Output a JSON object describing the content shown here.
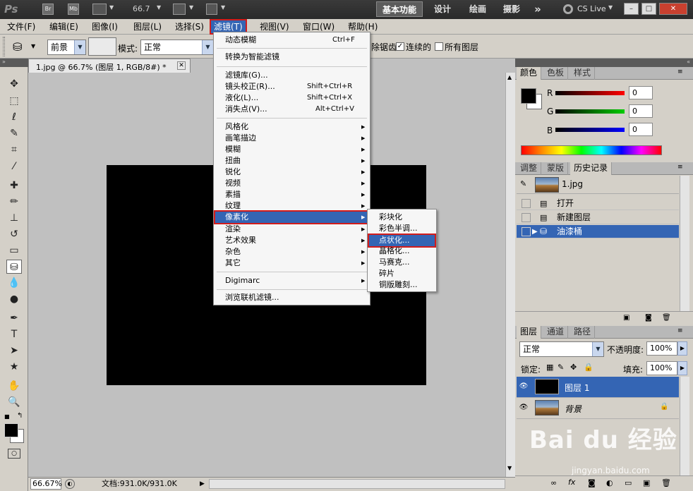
{
  "titlebar": {
    "logo": "Ps",
    "bridge": "Br",
    "minibridge": "Mb",
    "zoom": "66.7",
    "workspaces": [
      "基本功能",
      "设计",
      "绘画",
      "摄影"
    ],
    "more": "»",
    "cslive": "CS Live",
    "win_min": "–",
    "win_max": "□",
    "win_close": "✕"
  },
  "menubar": [
    "文件(F)",
    "编辑(E)",
    "图像(I)",
    "图层(L)",
    "选择(S)",
    "滤镜(T)",
    "视图(V)",
    "窗口(W)",
    "帮助(H)"
  ],
  "options": {
    "fill_source": "前景",
    "mode_label": "模式:",
    "mode_value": "正常",
    "antialias": "除锯齿",
    "contiguous": "连续的",
    "all_layers": "所有图层"
  },
  "document": {
    "tab_title": "1.jpg @ 66.7% (图层 1, RGB/8#) *",
    "zoom": "66.67%",
    "doc_size": "文档:931.0K/931.0K"
  },
  "filter_menu": {
    "items": [
      {
        "label": "动态模糊",
        "shortcut": "Ctrl+F"
      },
      {
        "label": "转换为智能滤镜",
        "shortcut": ""
      },
      {
        "label": "滤镜库(G)...",
        "shortcut": ""
      },
      {
        "label": "镜头校正(R)...",
        "shortcut": "Shift+Ctrl+R"
      },
      {
        "label": "液化(L)...",
        "shortcut": "Shift+Ctrl+X"
      },
      {
        "label": "消失点(V)...",
        "shortcut": "Alt+Ctrl+V"
      },
      {
        "label": "风格化",
        "shortcut": ""
      },
      {
        "label": "画笔描边",
        "shortcut": ""
      },
      {
        "label": "模糊",
        "shortcut": ""
      },
      {
        "label": "扭曲",
        "shortcut": ""
      },
      {
        "label": "锐化",
        "shortcut": ""
      },
      {
        "label": "视频",
        "shortcut": ""
      },
      {
        "label": "素描",
        "shortcut": ""
      },
      {
        "label": "纹理",
        "shortcut": ""
      },
      {
        "label": "像素化",
        "shortcut": ""
      },
      {
        "label": "渲染",
        "shortcut": ""
      },
      {
        "label": "艺术效果",
        "shortcut": ""
      },
      {
        "label": "杂色",
        "shortcut": ""
      },
      {
        "label": "其它",
        "shortcut": ""
      },
      {
        "label": "Digimarc",
        "shortcut": ""
      },
      {
        "label": "浏览联机滤镜...",
        "shortcut": ""
      }
    ]
  },
  "pixelate_menu": [
    "彩块化",
    "彩色半调...",
    "点状化...",
    "晶格化...",
    "马赛克...",
    "碎片",
    "铜版雕刻..."
  ],
  "color_panel": {
    "tabs": [
      "颜色",
      "色板",
      "样式"
    ],
    "r_label": "R",
    "g_label": "G",
    "b_label": "B",
    "r_value": "0",
    "g_value": "0",
    "b_value": "0"
  },
  "history_panel": {
    "tabs": [
      "调整",
      "蒙版",
      "历史记录"
    ],
    "snapshot": "1.jpg",
    "steps": [
      "打开",
      "新建图层",
      "油漆桶"
    ]
  },
  "layers_panel": {
    "tabs": [
      "图层",
      "通道",
      "路径"
    ],
    "blend_mode": "正常",
    "opacity_label": "不透明度:",
    "opacity_value": "100%",
    "lock_label": "锁定:",
    "fill_label": "填充:",
    "fill_value": "100%",
    "layers": [
      "图层 1",
      "背景"
    ]
  },
  "watermark": {
    "brand": "Bai du 经验",
    "url": "jingyan.baidu.com"
  },
  "colors": {
    "accent": "#3465b4",
    "highlight_border": "#d21c1c"
  }
}
